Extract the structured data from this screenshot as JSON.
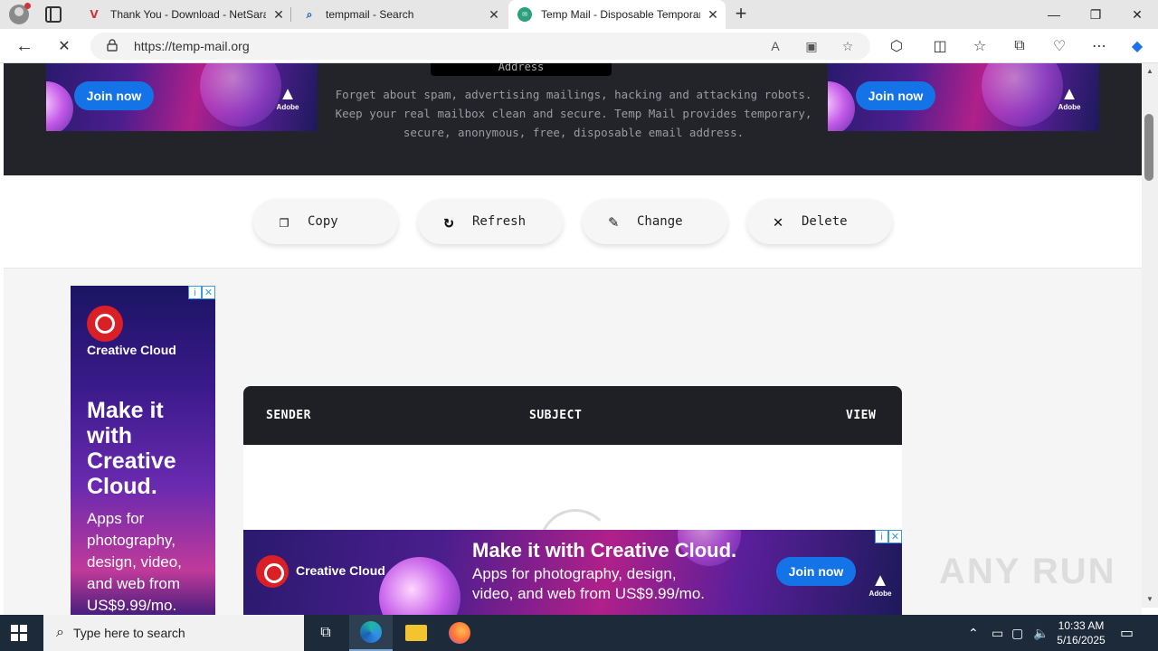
{
  "browser": {
    "tabs": [
      {
        "title": "Thank You - Download - NetSarang",
        "favicon": "netsarang-icon"
      },
      {
        "title": "tempmail - Search",
        "favicon": "search-icon"
      },
      {
        "title": "Temp Mail - Disposable Temporary Email",
        "favicon": "tempmail-icon"
      }
    ],
    "url": "https://temp-mail.org"
  },
  "page": {
    "address_label": "Address",
    "hero_text": "Forget about spam, advertising mailings, hacking and attacking robots. Keep your real mailbox clean and secure. Temp Mail provides temporary, secure, anonymous, free, disposable email address.",
    "actions": [
      {
        "label": "Copy",
        "icon": "copy-icon"
      },
      {
        "label": "Refresh",
        "icon": "refresh-icon"
      },
      {
        "label": "Change",
        "icon": "edit-icon"
      },
      {
        "label": "Delete",
        "icon": "delete-icon"
      }
    ],
    "mail_table": {
      "headers": [
        "SENDER",
        "SUBJECT",
        "VIEW"
      ]
    }
  },
  "ads": {
    "top_left": {
      "cta": "Join now",
      "brand": "Adobe"
    },
    "top_right": {
      "cta": "Join now",
      "brand": "Adobe"
    },
    "side": {
      "product": "Creative Cloud",
      "headline": "Make it with Creative Cloud.",
      "body": "Apps for photography, design, video, and web from US$9.99/mo."
    },
    "bottom": {
      "product": "Creative Cloud",
      "headline": "Make it with Creative Cloud.",
      "body": "Apps for photography, design, video, and web from US$9.99/mo.",
      "cta": "Join now",
      "brand": "Adobe"
    }
  },
  "watermark": "ANY RUN",
  "taskbar": {
    "search_placeholder": "Type here to search",
    "time": "10:33 AM",
    "date": "5/16/2025"
  },
  "colors": {
    "hero_bg": "#23242a",
    "adobe_blue": "#1473e6",
    "adobe_red": "#da1f26"
  }
}
